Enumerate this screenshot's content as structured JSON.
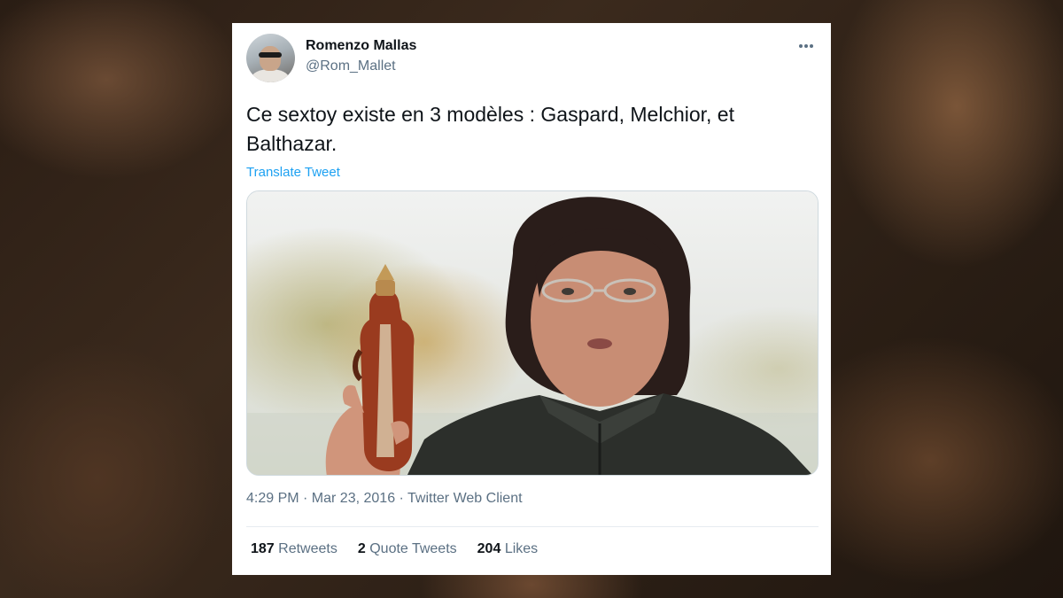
{
  "tweet": {
    "author_name": "Romenzo Mallas",
    "author_handle": "@Rom_Mallet",
    "text": "Ce sextoy existe en 3 modèles :  Gaspard, Melchior, et Balthazar.",
    "translate_label": "Translate Tweet",
    "meta": "4:29 PM · Mar 23, 2016 · Twitter Web Client",
    "stats": [
      {
        "value": "187",
        "label": "Retweets"
      },
      {
        "value": "2",
        "label": "Quote Tweets"
      },
      {
        "value": "204",
        "label": "Likes"
      }
    ],
    "more_icon": "more-icon",
    "accent_color": "#1da1f2",
    "secondary_color": "#5b7083"
  }
}
